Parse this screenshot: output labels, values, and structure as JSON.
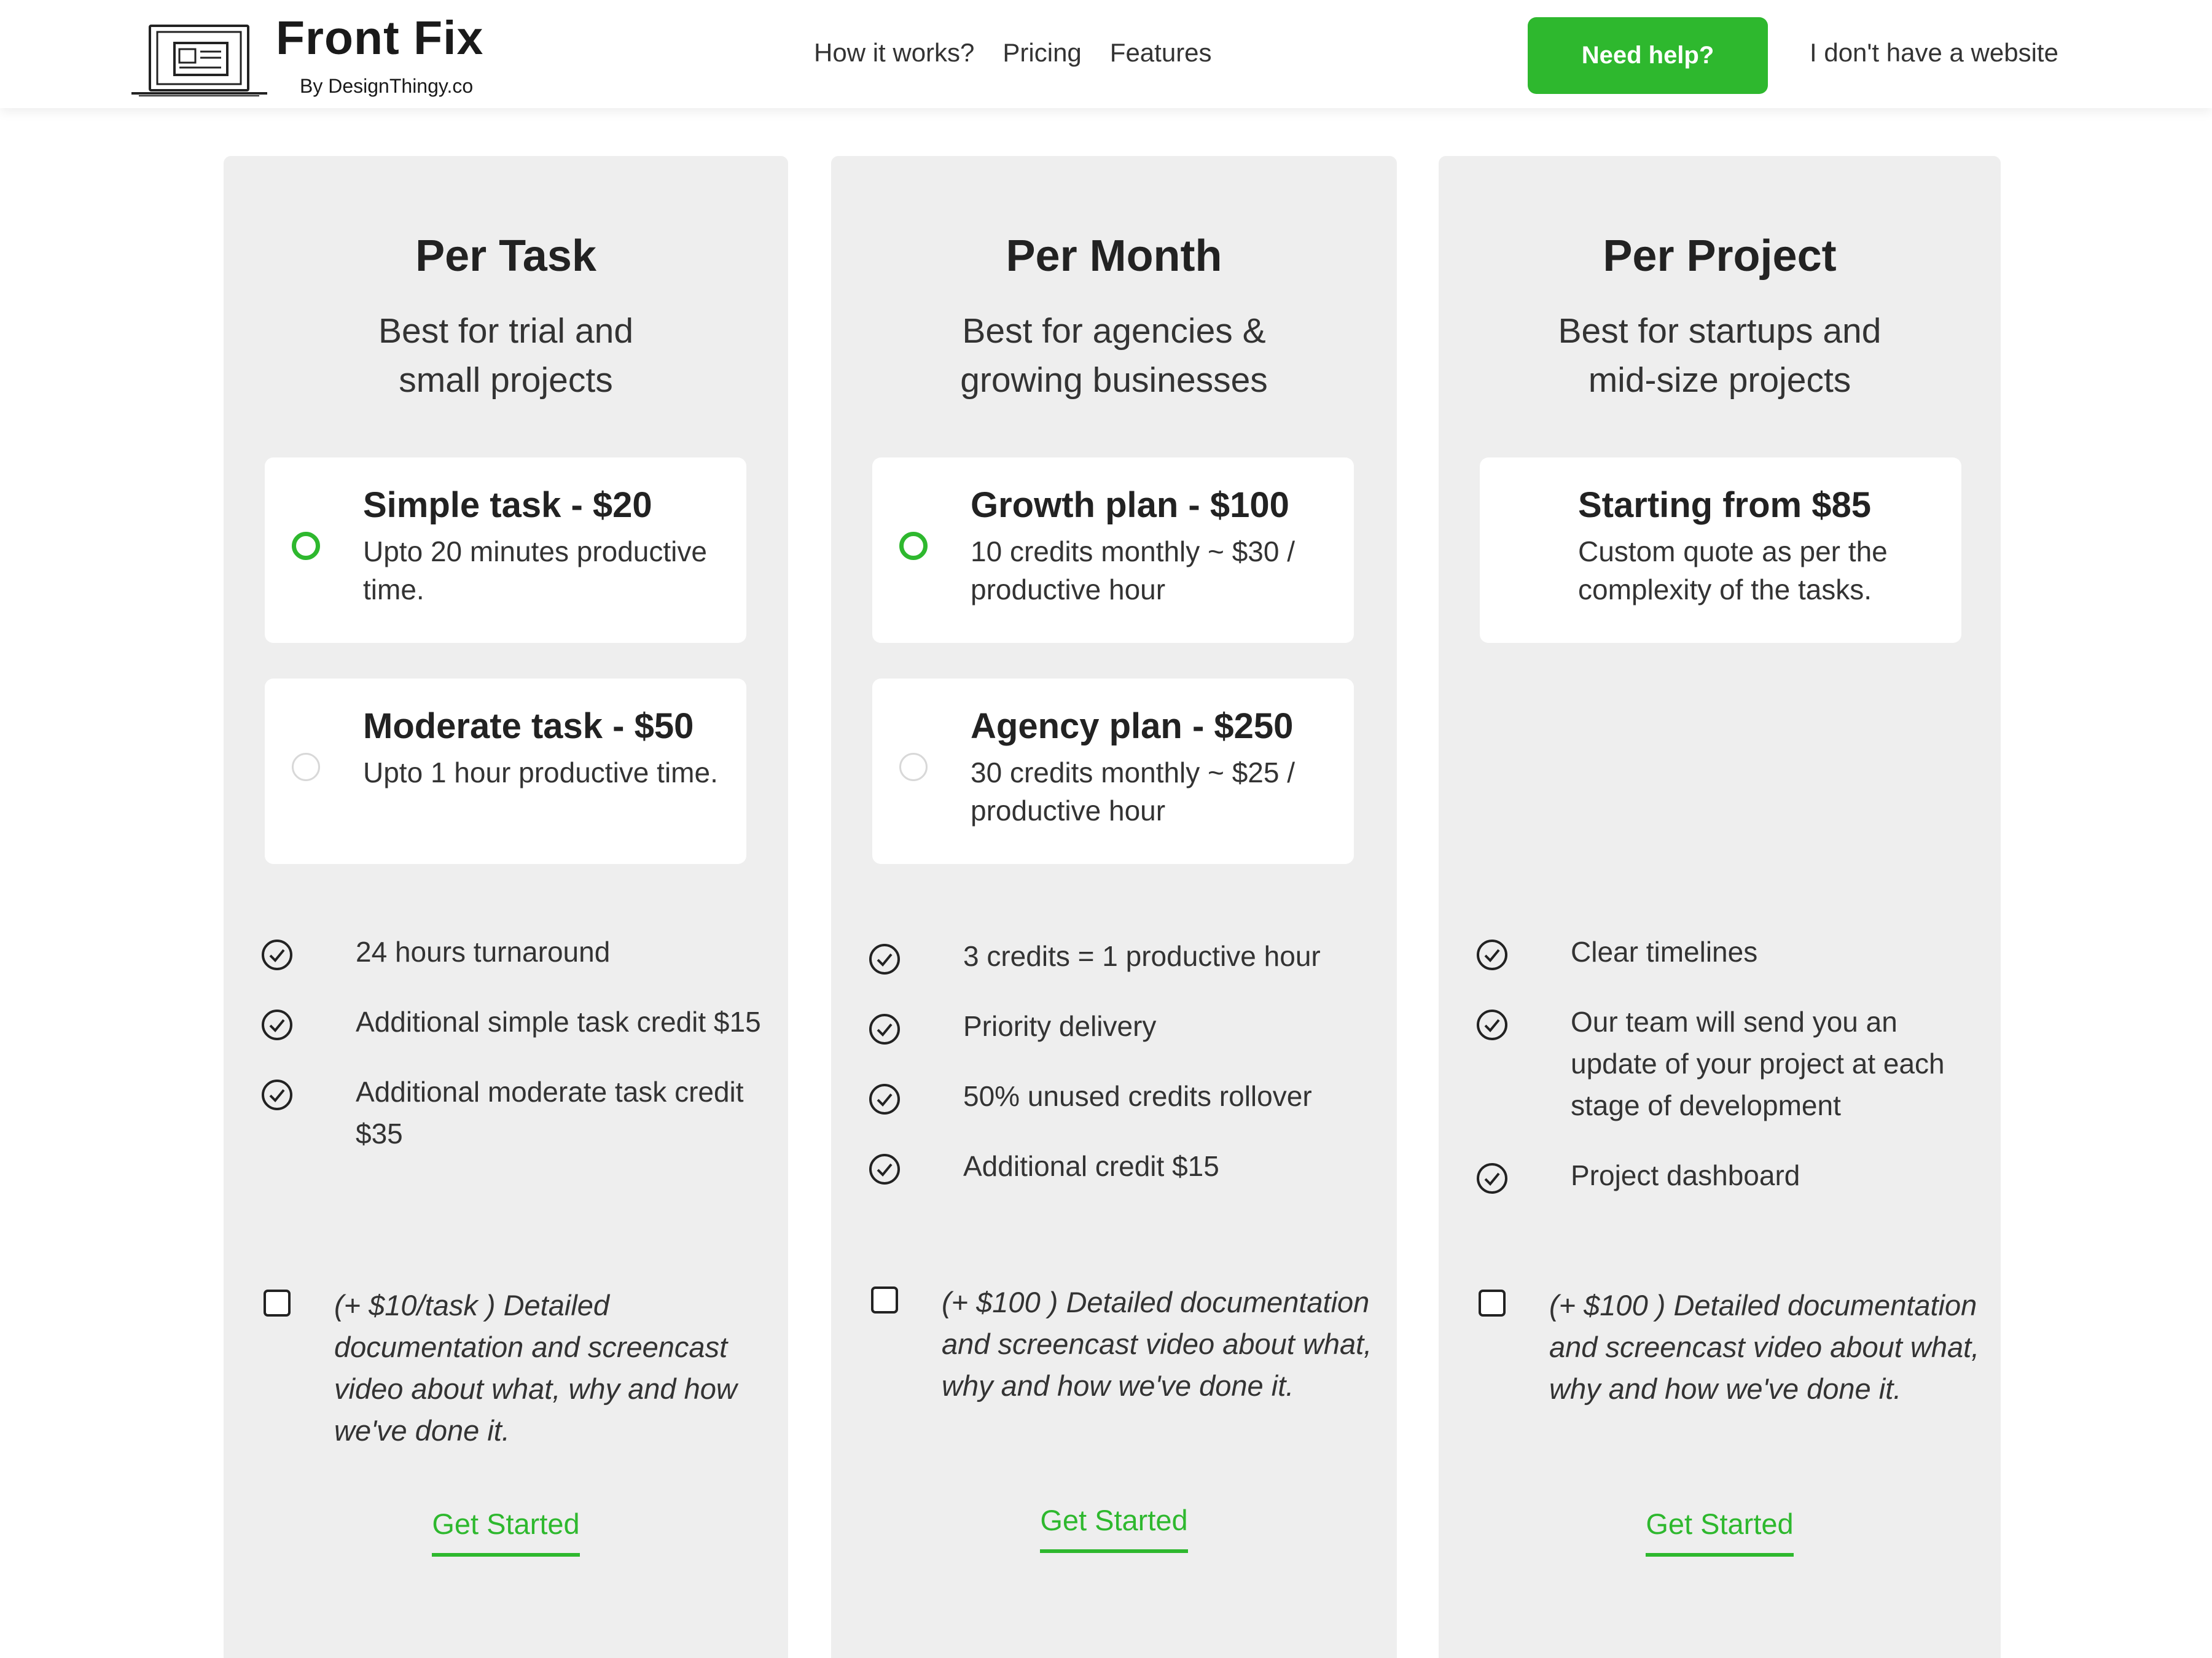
{
  "header": {
    "brand_name": "Front Fix",
    "brand_by": "By DesignThingy.co",
    "logo_icon": "laptop-icon",
    "nav": [
      "How it works?",
      "Pricing",
      "Features"
    ],
    "help_button": "Need help?",
    "no_website_link": "I don't have a website"
  },
  "colors": {
    "accent": "#2eb82e",
    "card_bg": "#eeeeee",
    "text": "#222222"
  },
  "plans": [
    {
      "title": "Per Task",
      "subtitle": [
        "Best for trial and",
        "small projects"
      ],
      "options": [
        {
          "title": "Simple task - $20",
          "desc": "Upto 20 minutes productive time.",
          "selected": true
        },
        {
          "title": "Moderate task - $50",
          "desc": "Upto 1 hour productive time.",
          "selected": false
        }
      ],
      "features": [
        "24 hours turnaround",
        "Additional simple task credit $15",
        "Additional moderate task credit $35"
      ],
      "addon": "(+ $10/task ) Detailed documentation and screencast video about what, why and how we've done it.",
      "cta": "Get Started"
    },
    {
      "title": "Per Month",
      "subtitle": [
        "Best for agencies &",
        "growing businesses"
      ],
      "options": [
        {
          "title": "Growth plan - $100",
          "desc": "10 credits monthly ~ $30 / productive hour",
          "selected": true
        },
        {
          "title": "Agency plan - $250",
          "desc": "30 credits monthly ~ $25 / productive hour",
          "selected": false
        }
      ],
      "features": [
        "3 credits = 1 productive hour",
        "Priority delivery",
        "50% unused credits rollover",
        "Additional credit $15"
      ],
      "addon": "(+ $100 ) Detailed documentation and screencast video about what, why and how we've done it.",
      "cta": "Get Started"
    },
    {
      "title": "Per Project",
      "subtitle": [
        "Best for startups and",
        "mid-size projects"
      ],
      "options": [
        {
          "title": "Starting from $85",
          "desc": "Custom quote as per the complexity of the tasks."
        }
      ],
      "features": [
        "Clear timelines",
        "Our team will send you an update of your project at each stage of development",
        "Project dashboard"
      ],
      "addon": "(+ $100 ) Detailed documentation and screencast video about what, why and how we've done it.",
      "cta": "Get Started"
    }
  ]
}
